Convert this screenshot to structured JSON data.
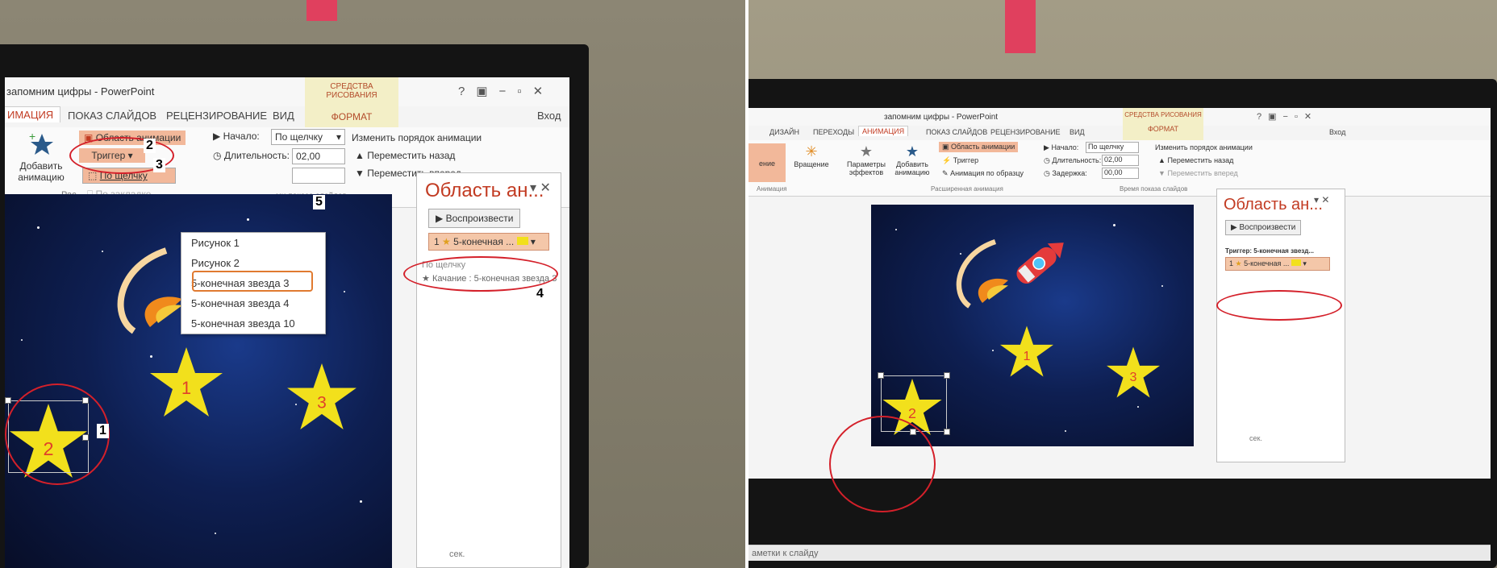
{
  "left": {
    "window_title": "запомним цифры - PowerPoint",
    "contextual_group": "СРЕДСТВА РИСОВАНИЯ",
    "contextual_tab": "ФОРМАТ",
    "help": "?",
    "sign_in": "Вход",
    "tabs": [
      "ИМАЦИЯ",
      "ПОКАЗ СЛАЙДОВ",
      "РЕЦЕНЗИРОВАНИЕ",
      "ВИД"
    ],
    "ribbon": {
      "add_animation": "Добавить анимацию",
      "animation_pane": "Область анимации",
      "trigger": "Триггер",
      "on_click": "По щелчку",
      "on_bookmark": "По закладке",
      "start_label": "Начало:",
      "start_value": "По щелчку",
      "duration_label": "Длительность:",
      "duration_value": "02,00",
      "reorder_title": "Изменить порядок анимации",
      "move_back": "Переместить назад",
      "move_forward": "Переместить вперед",
      "group_timing_partial": "ми показа слайдов",
      "group_left_partial": "Рас"
    },
    "trigger_menu": [
      "Рисунок 1",
      "Рисунок 2",
      "5-конечная звезда 3",
      "5-конечная звезда 4",
      "5-конечная звезда 10"
    ],
    "pane": {
      "title": "Область ан...",
      "play": "Воспроизвести",
      "item": "5-конечная ...",
      "item_num": "1",
      "sub_header": "По щелчку",
      "sub_item": "Качание : 5-конечная звезда 3"
    },
    "stars": [
      "1",
      "2",
      "3"
    ],
    "marks": [
      "1",
      "2",
      "3",
      "4",
      "5"
    ],
    "footer": "сек."
  },
  "right": {
    "window_title": "запомним цифры - PowerPoint",
    "contextual_group": "СРЕДСТВА РИСОВАНИЯ",
    "contextual_tab": "ФОРМАТ",
    "help": "?",
    "sign_in": "Вход",
    "tabs": [
      "ДИЗАЙН",
      "ПЕРЕХОДЫ",
      "АНИМАЦИЯ",
      "ПОКАЗ СЛАЙДОВ",
      "РЕЦЕНЗИРОВАНИЕ",
      "ВИД"
    ],
    "ribbon": {
      "effect_partial": "ение",
      "rotation": "Вращение",
      "effect_params": "Параметры эффектов",
      "add_animation": "Добавить анимацию",
      "animation_pane": "Область анимации",
      "trigger": "Триггер",
      "anim_painter": "Анимация по образцу",
      "start_label": "Начало:",
      "start_value": "По щелчку",
      "duration_label": "Длительность:",
      "duration_value": "02,00",
      "delay_label": "Задержка:",
      "delay_value": "00,00",
      "reorder_title": "Изменить порядок анимации",
      "move_back": "Переместить назад",
      "move_forward": "Переместить вперед",
      "group_animation": "Анимация",
      "group_advanced": "Расширенная анимация",
      "group_timing": "Время показа слайдов"
    },
    "pane": {
      "title": "Область ан...",
      "play": "Воспроизвести",
      "trigger_header": "Триггер: 5-конечная звезд...",
      "item": "5-конечная ...",
      "item_num": "1"
    },
    "stars": [
      "1",
      "2",
      "3"
    ],
    "footer": "сек.",
    "status_partial": "аметки к слайду"
  },
  "colors": {
    "accent": "#c23b22",
    "highlight": "#f2b89a",
    "star_yellow": "#f2e01c",
    "star_number": "#e0402a",
    "ring_red": "#d4202a"
  }
}
